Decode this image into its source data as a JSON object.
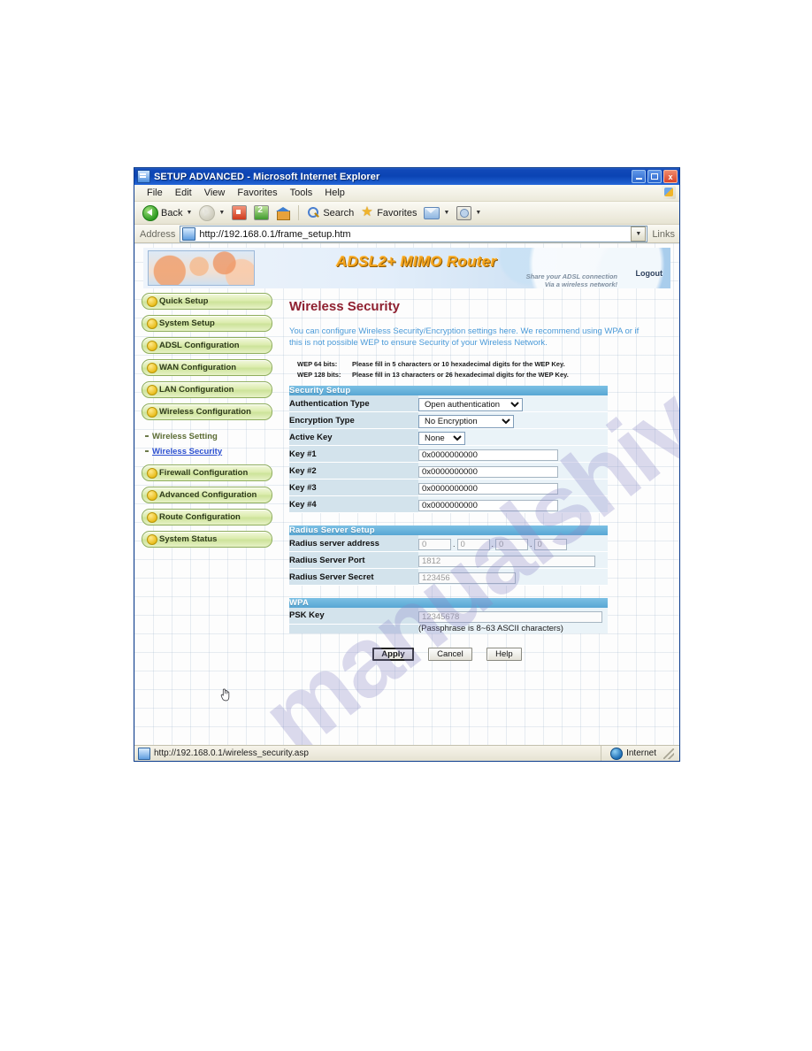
{
  "window": {
    "title": "SETUP ADVANCED - Microsoft Internet Explorer",
    "minimize_label": "Minimize",
    "maximize_label": "Maximize",
    "close_label": "x"
  },
  "menubar": [
    "File",
    "Edit",
    "View",
    "Favorites",
    "Tools",
    "Help"
  ],
  "toolbar": {
    "back": "Back",
    "forward": "",
    "stop": "",
    "refresh": "",
    "home": "",
    "search": "Search",
    "favorites": "Favorites",
    "mail": "",
    "media": ""
  },
  "address": {
    "label": "Address",
    "url": "http://192.168.0.1/frame_setup.htm",
    "links_label": "Links"
  },
  "banner": {
    "title": "ADSL2+ MIMO Router",
    "tagline_line1": "Share your ADSL connection",
    "tagline_line2": "Via a wireless network!",
    "logout": "Logout"
  },
  "sidebar": {
    "items": [
      {
        "label": "Quick Setup"
      },
      {
        "label": "System Setup"
      },
      {
        "label": "ADSL Configuration"
      },
      {
        "label": "WAN Configuration"
      },
      {
        "label": "LAN Configuration"
      },
      {
        "label": "Wireless Configuration"
      }
    ],
    "subitems": [
      {
        "label": "Wireless Setting",
        "active": false
      },
      {
        "label": "Wireless Security",
        "active": true
      }
    ],
    "items_after": [
      {
        "label": "Firewall Configuration"
      },
      {
        "label": "Advanced Configuration"
      },
      {
        "label": "Route Configuration"
      },
      {
        "label": "System Status"
      }
    ]
  },
  "main": {
    "title": "Wireless Security",
    "description": "You can configure Wireless Security/Encryption settings here. We recommend using WPA or if this is not possible WEP to ensure Security of your Wireless Network.",
    "notes": [
      {
        "label": "WEP 64 bits:",
        "text": "Please fill in 5 characters or 10 hexadecimal digits for the WEP Key."
      },
      {
        "label": "WEP 128 bits:",
        "text": "Please fill in 13 characters or 26 hexadecimal digits for the WEP Key."
      }
    ],
    "security_setup": {
      "heading": "Security Setup",
      "authentication_type": {
        "label": "Authentication Type",
        "value": "Open authentication"
      },
      "encryption_type": {
        "label": "Encryption Type",
        "value": "No Encryption"
      },
      "active_key": {
        "label": "Active Key",
        "value": "None"
      },
      "keys": [
        {
          "label": "Key #1",
          "value": "0x0000000000"
        },
        {
          "label": "Key #2",
          "value": "0x0000000000"
        },
        {
          "label": "Key #3",
          "value": "0x0000000000"
        },
        {
          "label": "Key #4",
          "value": "0x0000000000"
        }
      ]
    },
    "radius_setup": {
      "heading": "Radius Server Setup",
      "address": {
        "label": "Radius server address",
        "octets": [
          "0",
          "0",
          "0",
          "0"
        ]
      },
      "port": {
        "label": "Radius Server Port",
        "value": "1812"
      },
      "secret": {
        "label": "Radius Server Secret",
        "value": "123456"
      }
    },
    "wpa": {
      "heading": "WPA",
      "psk": {
        "label": "PSK Key",
        "value": "12345678"
      },
      "hint": "(Passphrase is 8~63 ASCII characters)"
    },
    "buttons": {
      "apply": "Apply",
      "cancel": "Cancel",
      "help": "Help"
    }
  },
  "statusbar": {
    "url": "http://192.168.0.1/wireless_security.asp",
    "zone": "Internet"
  },
  "watermark": {
    "text": "manualshive"
  },
  "colors": {
    "titlebar_blue": "#0b44b4",
    "section_header": "#58a7d4",
    "label_cell": "#d3e3ec",
    "page_title_red": "#8f2030",
    "description_blue": "#4a9ad8",
    "nav_green": "#cde39a",
    "link_blue": "#2b4fd0"
  }
}
